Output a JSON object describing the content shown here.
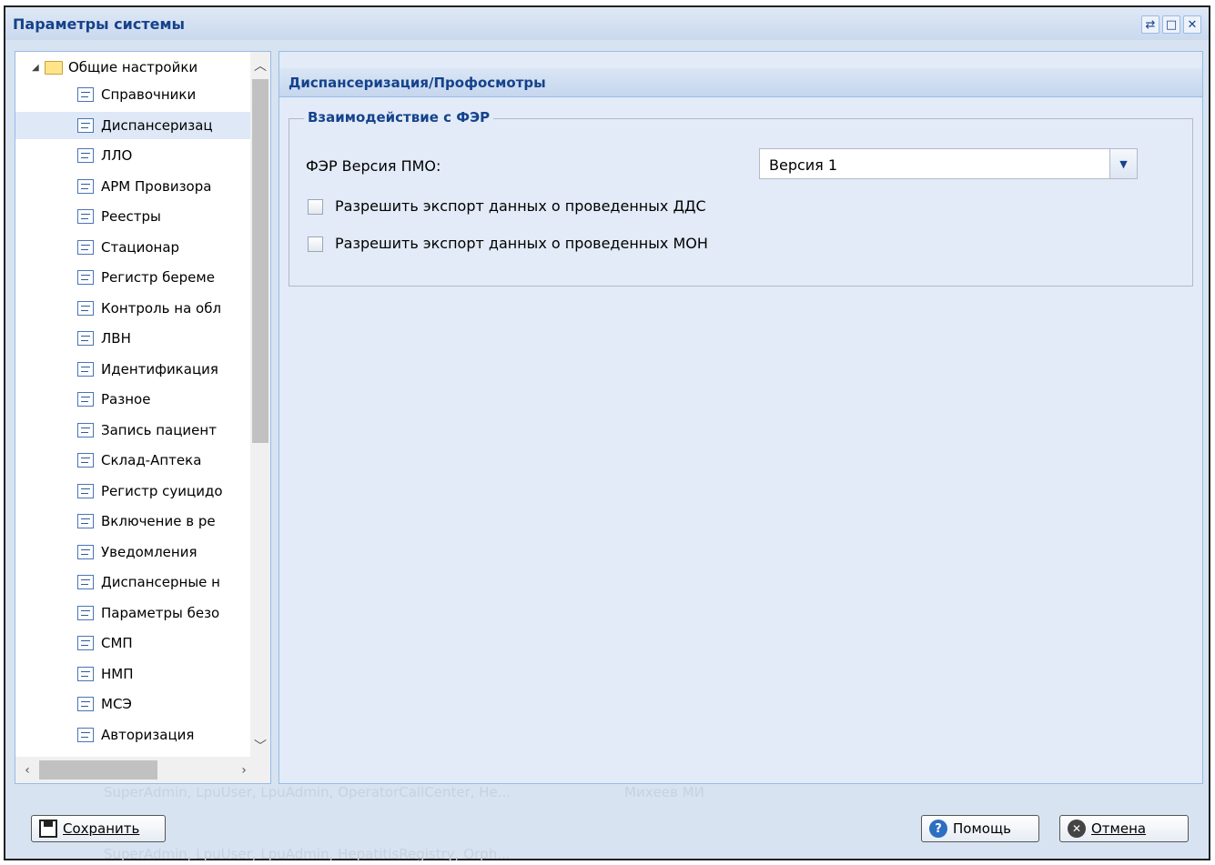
{
  "window": {
    "title": "Параметры системы",
    "tools": [
      "⇄",
      "□",
      "✕"
    ]
  },
  "tree": {
    "root": {
      "label": "Общие настройки",
      "expanded": true
    },
    "items": [
      {
        "label": "Справочники"
      },
      {
        "label": "Диспансеризац",
        "selected": true
      },
      {
        "label": "ЛЛО"
      },
      {
        "label": "АРМ Провизора"
      },
      {
        "label": "Реестры"
      },
      {
        "label": "Стационар"
      },
      {
        "label": "Регистр береме"
      },
      {
        "label": "Контроль на обл"
      },
      {
        "label": "ЛВН"
      },
      {
        "label": "Идентификация"
      },
      {
        "label": "Разное"
      },
      {
        "label": "Запись пациент"
      },
      {
        "label": "Склад-Аптека"
      },
      {
        "label": "Регистр суицидо"
      },
      {
        "label": "Включение в ре"
      },
      {
        "label": "Уведомления"
      },
      {
        "label": "Диспансерные н"
      },
      {
        "label": "Параметры безо"
      },
      {
        "label": "СМП"
      },
      {
        "label": "НМП"
      },
      {
        "label": "МСЭ"
      },
      {
        "label": "Авторизация"
      }
    ]
  },
  "panel": {
    "title": "Диспансеризация/Профосмотры",
    "fieldset": {
      "legend": "Взаимодействие с ФЭР",
      "version_label": "ФЭР Версия ПМО:",
      "version_value": "Версия 1",
      "checkboxes": [
        {
          "label": "Разрешить экспорт данных о проведенных ДДС",
          "checked": false
        },
        {
          "label": "Разрешить экспорт данных о проведенных МОН",
          "checked": false
        }
      ]
    }
  },
  "footer": {
    "ghost_line1": "SuperAdmin, LpuUser, LpuAdmin, OperatorCallCenter, He...",
    "ghost_user": "Михеев МИ",
    "ghost_line2": "SuperAdmin, LpuUser, LpuAdmin, HepatitisRegistry, Orph...",
    "save_label": "Сохранить",
    "help_label": "Помощь",
    "cancel_label": "Отмена"
  },
  "colors": {
    "title_text": "#15428b",
    "panel_bg": "#e2ebf7",
    "border": "#99bbe8",
    "selected_row": "#dfe8f6"
  }
}
